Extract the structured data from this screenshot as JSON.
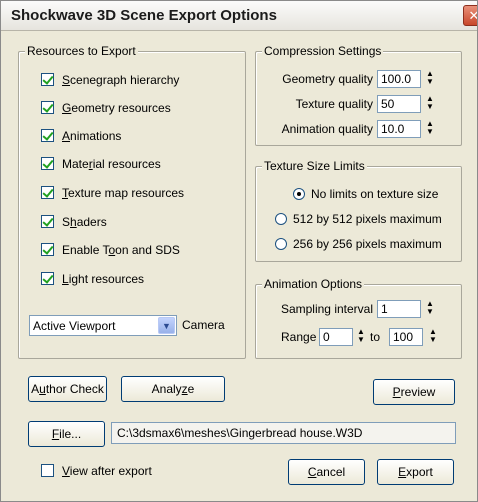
{
  "window": {
    "title": "Shockwave 3D Scene Export Options",
    "close_glyph": "✕"
  },
  "resources": {
    "title": "Resources to Export",
    "items": [
      {
        "pre": "",
        "ul": "S",
        "post": "cenegraph hierarchy",
        "checked": true
      },
      {
        "pre": "",
        "ul": "G",
        "post": "eometry resources",
        "checked": true
      },
      {
        "pre": "",
        "ul": "A",
        "post": "nimations",
        "checked": true
      },
      {
        "pre": "Mate",
        "ul": "r",
        "post": "ial resources",
        "checked": true
      },
      {
        "pre": "",
        "ul": "T",
        "post": "exture map resources",
        "checked": true
      },
      {
        "pre": "S",
        "ul": "h",
        "post": "aders",
        "checked": true
      },
      {
        "pre": "Enable T",
        "ul": "o",
        "post": "on and SDS",
        "checked": true
      },
      {
        "pre": "",
        "ul": "L",
        "post": "ight resources",
        "checked": true
      }
    ],
    "viewport_select": "Active Viewport",
    "camera_label": "Camera"
  },
  "compression": {
    "title": "Compression Settings",
    "geometry_label": "Geometry quality",
    "geometry_value": "100.0",
    "texture_label": "Texture quality",
    "texture_value": "50",
    "animation_label": "Animation quality",
    "animation_value": "10.0"
  },
  "texture_limits": {
    "title": "Texture Size Limits",
    "options": [
      {
        "label": "No limits on texture size",
        "selected": true
      },
      {
        "label": "512 by 512 pixels maximum",
        "selected": false
      },
      {
        "label": "256 by 256 pixels maximum",
        "selected": false
      }
    ]
  },
  "animation": {
    "title": "Animation Options",
    "sampling_label": "Sampling interval",
    "sampling_value": "1",
    "range_label": "Range",
    "range_from": "0",
    "range_to_label": "to",
    "range_to": "100"
  },
  "buttons": {
    "author_check": {
      "pre": "A",
      "ul": "u",
      "post": "thor Check"
    },
    "analyze": {
      "pre": "Analy",
      "ul": "z",
      "post": "e"
    },
    "preview": {
      "pre": "",
      "ul": "P",
      "post": "review"
    },
    "file": {
      "pre": "",
      "ul": "F",
      "post": "ile..."
    },
    "cancel": {
      "pre": "",
      "ul": "C",
      "post": "ancel"
    },
    "export": {
      "pre": "",
      "ul": "E",
      "post": "xport"
    }
  },
  "file_path": "C:\\3dsmax6\\meshes\\Gingerbread house.W3D",
  "view_after_export": {
    "pre": "",
    "ul": "V",
    "post": "iew after export",
    "checked": false
  },
  "spin_glyphs": {
    "up": "▲",
    "down": "▼"
  },
  "dropdown_glyph": "▼"
}
